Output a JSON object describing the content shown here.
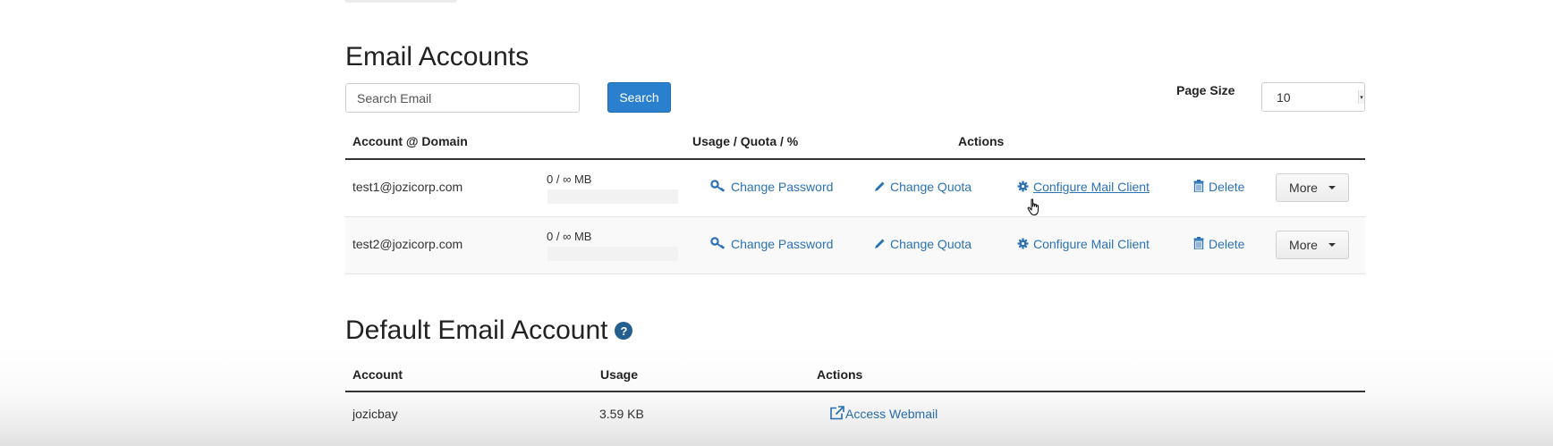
{
  "email_accounts": {
    "title": "Email Accounts",
    "search": {
      "placeholder": "Search Email",
      "value": "",
      "button_label": "Search"
    },
    "page_size": {
      "label": "Page Size",
      "value": "10"
    },
    "headers": {
      "account": "Account @ Domain",
      "usage": "Usage / Quota / %",
      "actions": "Actions"
    },
    "rows": [
      {
        "account": "test1@jozicorp.com",
        "usage": "0 / ∞ MB",
        "actions": {
          "change_password": "Change Password",
          "change_quota": "Change Quota",
          "configure_mail_client": "Configure Mail Client",
          "delete": "Delete",
          "more": "More"
        }
      },
      {
        "account": "test2@jozicorp.com",
        "usage": "0 / ∞ MB",
        "actions": {
          "change_password": "Change Password",
          "change_quota": "Change Quota",
          "configure_mail_client": "Configure Mail Client",
          "delete": "Delete",
          "more": "More"
        }
      }
    ]
  },
  "default_account": {
    "title": "Default Email Account",
    "help_icon": "?",
    "headers": {
      "account": "Account",
      "usage": "Usage",
      "actions": "Actions"
    },
    "row": {
      "account": "jozicbay",
      "usage": "3.59 KB",
      "action": "Access Webmail"
    }
  },
  "icons": {
    "change_password": "key-icon",
    "change_quota": "pencil-icon",
    "configure_mail_client": "gear-icon",
    "delete": "trash-icon",
    "access_webmail": "external-link-icon",
    "help": "question-circle-icon"
  },
  "colors": {
    "link": "#2a72b5",
    "primary_button": "#2a80cc",
    "help_icon": "#23608f"
  }
}
